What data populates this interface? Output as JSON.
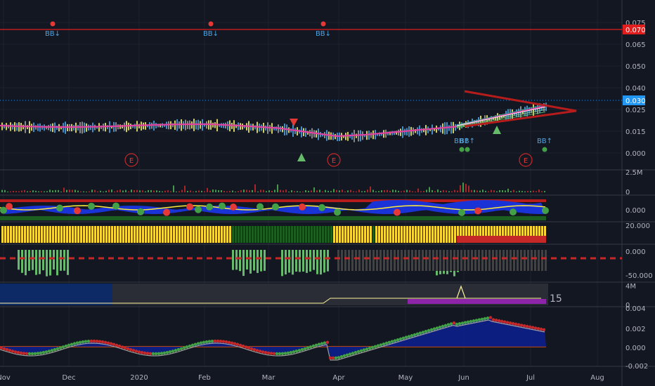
{
  "chart_data": {
    "type": "candlestick",
    "x_axis": {
      "tick_labels": [
        "Nov",
        "Dec",
        "2020",
        "Feb",
        "Mar",
        "Apr",
        "May",
        "Jun",
        "Jul",
        "Aug"
      ]
    },
    "price_pane": {
      "y_ticks": [
        "0.075",
        "0.065",
        "0.050",
        "0.040",
        "0.025",
        "0.015",
        "0.000"
      ],
      "current_price_label": "0.030",
      "level_label": "0.070",
      "level_color": "#e01e1e",
      "current_color": "#2196f3",
      "markers": {
        "bb_down": [
          "BB↓",
          "BB↓",
          "BB↓"
        ],
        "bb_up": [
          "BB↑",
          "BB↑",
          "BB↑"
        ],
        "earnings": [
          "E",
          "E",
          "E"
        ]
      },
      "series_approx": {
        "x": [
          "Nov",
          "Dec",
          "2020",
          "Feb",
          "Mar",
          "Apr",
          "May",
          "Jun",
          "Jul"
        ],
        "close": [
          0.016,
          0.015,
          0.014,
          0.015,
          0.013,
          0.011,
          0.014,
          0.018,
          0.03
        ]
      }
    },
    "volume_pane": {
      "y_ticks": [
        "2.5M",
        "0"
      ]
    },
    "osc_pane_1": {
      "y_ticks": [
        "0.000"
      ]
    },
    "osc_pane_2": {
      "y_ticks": [
        "20.000"
      ]
    },
    "osc_pane_3": {
      "y_ticks": [
        "0.000",
        "-50.000"
      ]
    },
    "osc_pane_4": {
      "y_ticks": [
        "4M",
        "0"
      ],
      "badge": "15"
    },
    "osc_pane_5": {
      "y_ticks": [
        "0.004",
        "0.002",
        "0.000",
        "-0.002"
      ]
    }
  }
}
